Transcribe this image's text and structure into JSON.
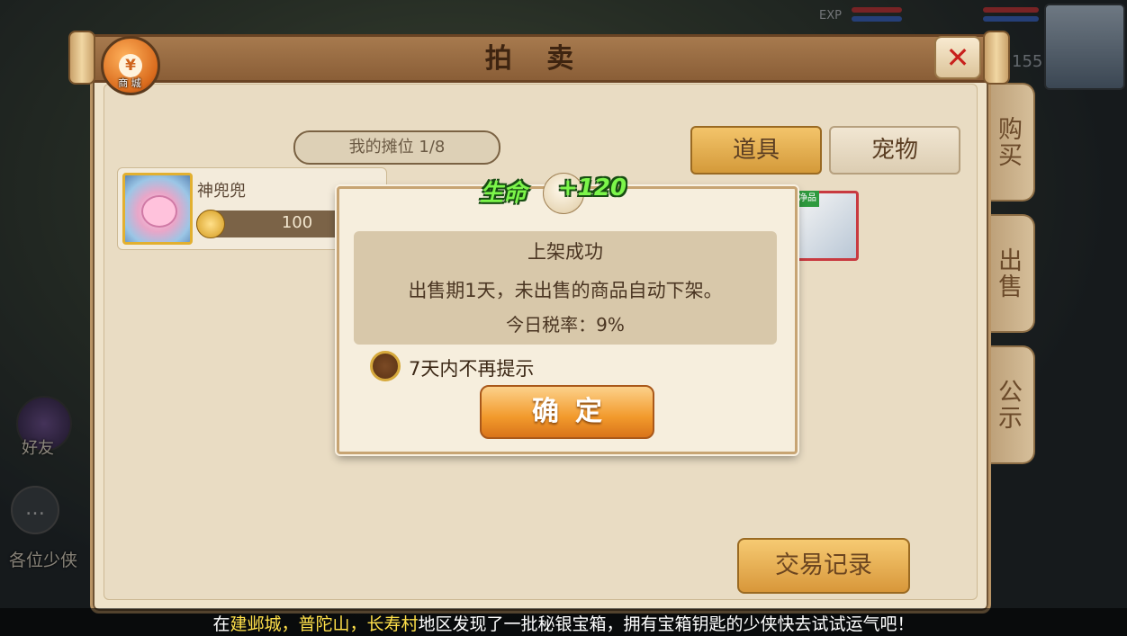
{
  "window": {
    "title": "拍 卖"
  },
  "shop_icon": {
    "symbol": "¥",
    "label": "商 城"
  },
  "side_tabs": [
    {
      "label": "购买"
    },
    {
      "label": "出售"
    },
    {
      "label": "公示"
    }
  ],
  "stall": {
    "label": "我的摊位 1/8"
  },
  "category_tabs": [
    {
      "label": "道具",
      "active": true
    },
    {
      "label": "宠物",
      "active": false
    }
  ],
  "listing": {
    "name": "神兜兜",
    "price": "100"
  },
  "other_item": {
    "tag": "净品"
  },
  "trade_button": {
    "label": "交易记录"
  },
  "close_button": {
    "label": "✕"
  },
  "effect": {
    "stat": "生命",
    "value": "+120"
  },
  "dialog": {
    "title": "上架成功",
    "line1": "出售期1天，未出售的商品自动下架。",
    "tax": "今日税率：9%",
    "checkbox_label": "7天内不再提示",
    "checked": false,
    "confirm_label": "确定"
  },
  "hud": {
    "friends_label": "好友",
    "chat_text": "各位少侠",
    "exp_label": "EXP",
    "level": "155"
  },
  "marquee": {
    "prefix": "在",
    "places": "建邺城，普陀山，长寿村",
    "suffix": "地区发现了一批秘银宝箱，拥有宝箱钥匙的少侠快去试试运气吧！"
  },
  "colors": {
    "panel_bg": "#eee2c9",
    "header_brown": "#8a5e37",
    "confirm_orange": "#f29a2c",
    "effect_green": "#7cf54a",
    "highlight_yellow": "#ffe04a"
  }
}
